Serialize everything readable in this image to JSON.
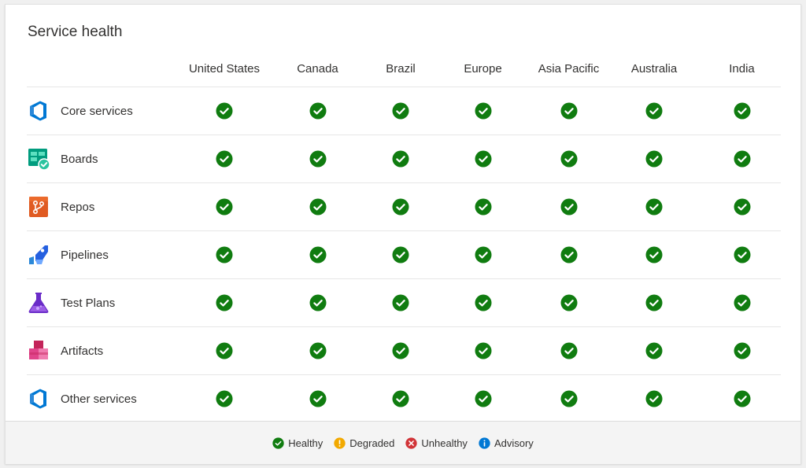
{
  "title": "Service health",
  "colors": {
    "healthy": "#107c10",
    "degraded": "#f2a900",
    "unhealthy": "#d13438",
    "advisory": "#0078d4"
  },
  "regions": [
    "United States",
    "Canada",
    "Brazil",
    "Europe",
    "Asia Pacific",
    "Australia",
    "India"
  ],
  "services": [
    {
      "label": "Core services",
      "icon": "azure-devops-icon",
      "statuses": [
        "healthy",
        "healthy",
        "healthy",
        "healthy",
        "healthy",
        "healthy",
        "healthy"
      ]
    },
    {
      "label": "Boards",
      "icon": "boards-icon",
      "statuses": [
        "healthy",
        "healthy",
        "healthy",
        "healthy",
        "healthy",
        "healthy",
        "healthy"
      ]
    },
    {
      "label": "Repos",
      "icon": "repos-icon",
      "statuses": [
        "healthy",
        "healthy",
        "healthy",
        "healthy",
        "healthy",
        "healthy",
        "healthy"
      ]
    },
    {
      "label": "Pipelines",
      "icon": "pipelines-icon",
      "statuses": [
        "healthy",
        "healthy",
        "healthy",
        "healthy",
        "healthy",
        "healthy",
        "healthy"
      ]
    },
    {
      "label": "Test Plans",
      "icon": "test-plans-icon",
      "statuses": [
        "healthy",
        "healthy",
        "healthy",
        "healthy",
        "healthy",
        "healthy",
        "healthy"
      ]
    },
    {
      "label": "Artifacts",
      "icon": "artifacts-icon",
      "statuses": [
        "healthy",
        "healthy",
        "healthy",
        "healthy",
        "healthy",
        "healthy",
        "healthy"
      ]
    },
    {
      "label": "Other services",
      "icon": "azure-devops-icon",
      "statuses": [
        "healthy",
        "healthy",
        "healthy",
        "healthy",
        "healthy",
        "healthy",
        "healthy"
      ]
    }
  ],
  "legend": [
    {
      "status": "healthy",
      "label": "Healthy"
    },
    {
      "status": "degraded",
      "label": "Degraded"
    },
    {
      "status": "unhealthy",
      "label": "Unhealthy"
    },
    {
      "status": "advisory",
      "label": "Advisory"
    }
  ]
}
